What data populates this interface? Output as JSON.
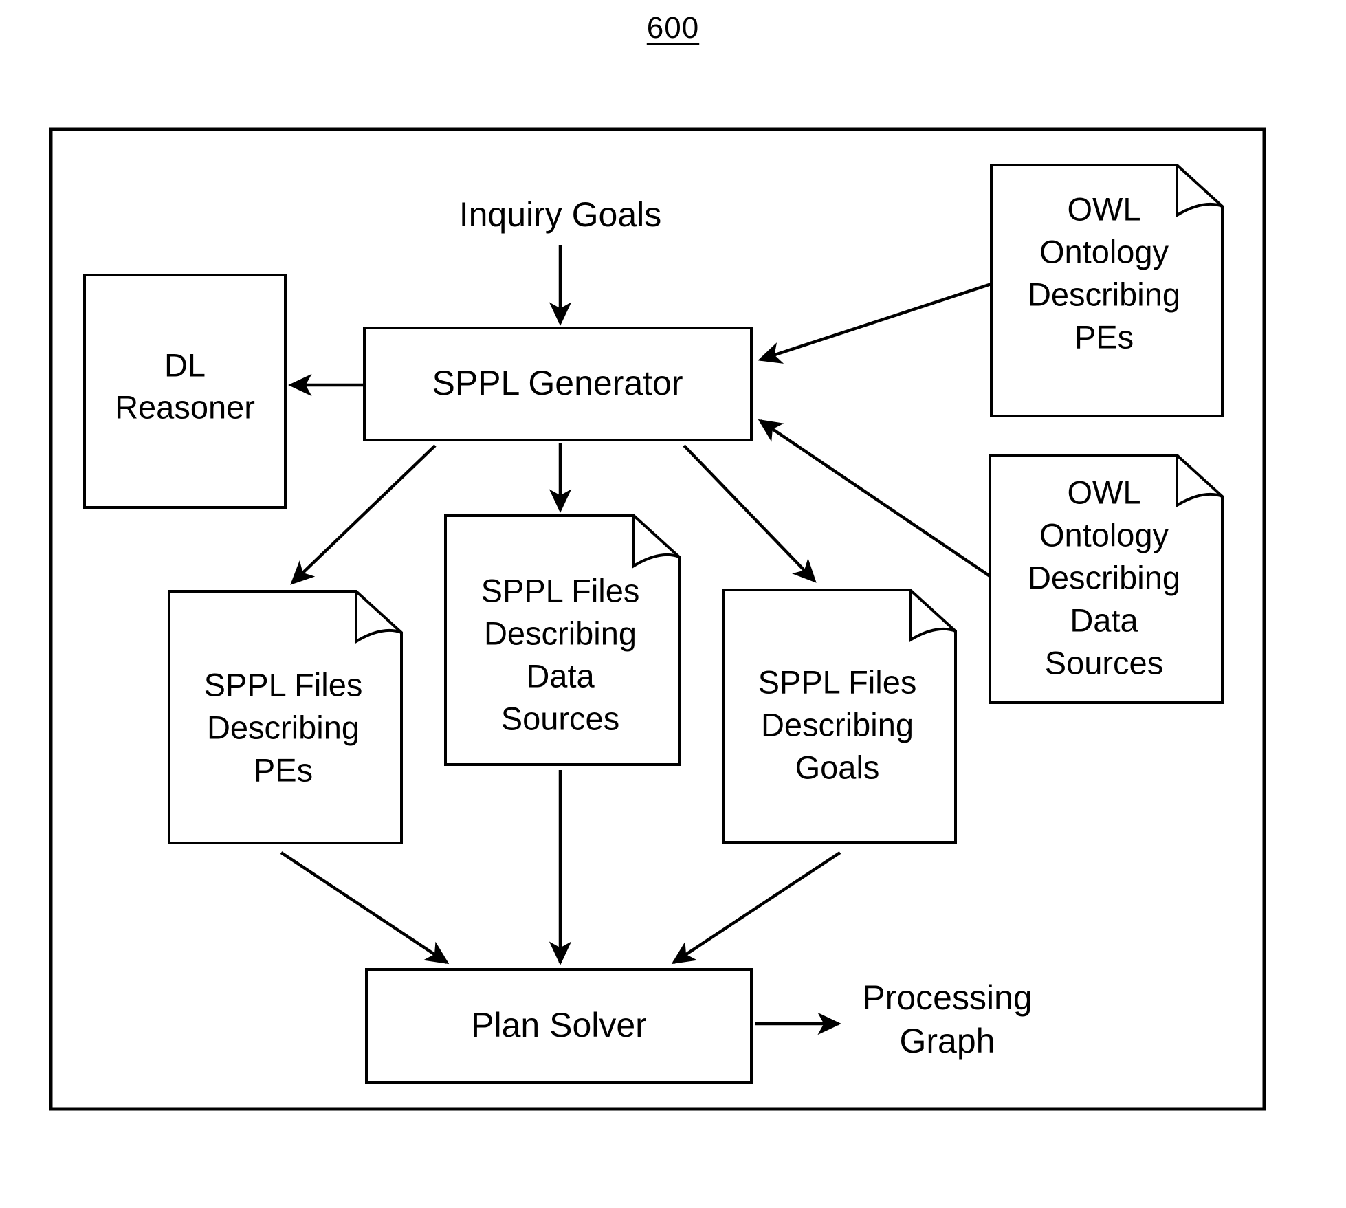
{
  "figure": {
    "number": "600"
  },
  "diagram": {
    "type": "flowchart",
    "nodes": [
      {
        "id": "inquiry-goals",
        "shape": "label",
        "lines": [
          "Inquiry Goals"
        ]
      },
      {
        "id": "dl-reasoner",
        "shape": "rect",
        "lines": [
          "DL",
          "Reasoner"
        ]
      },
      {
        "id": "sppl-generator",
        "shape": "rect",
        "lines": [
          "SPPL Generator"
        ]
      },
      {
        "id": "owl-ontology-pes",
        "shape": "document",
        "lines": [
          "OWL",
          "Ontology",
          "Describing",
          "PEs"
        ]
      },
      {
        "id": "owl-ontology-data-sources",
        "shape": "document",
        "lines": [
          "OWL",
          "Ontology",
          "Describing",
          "Data",
          "Sources"
        ]
      },
      {
        "id": "sppl-files-pes",
        "shape": "document",
        "lines": [
          "SPPL Files",
          "Describing",
          "PEs"
        ]
      },
      {
        "id": "sppl-files-data-sources",
        "shape": "document",
        "lines": [
          "SPPL Files",
          "Describing",
          "Data",
          "Sources"
        ]
      },
      {
        "id": "sppl-files-goals",
        "shape": "document",
        "lines": [
          "SPPL Files",
          "Describing",
          "Goals"
        ]
      },
      {
        "id": "plan-solver",
        "shape": "rect",
        "lines": [
          "Plan Solver"
        ]
      },
      {
        "id": "processing-graph",
        "shape": "label",
        "lines": [
          "Processing",
          "Graph"
        ]
      }
    ],
    "edges": [
      {
        "from": "inquiry-goals",
        "to": "sppl-generator"
      },
      {
        "from": "sppl-generator",
        "to": "dl-reasoner"
      },
      {
        "from": "owl-ontology-pes",
        "to": "sppl-generator"
      },
      {
        "from": "owl-ontology-data-sources",
        "to": "sppl-generator"
      },
      {
        "from": "sppl-generator",
        "to": "sppl-files-pes"
      },
      {
        "from": "sppl-generator",
        "to": "sppl-files-data-sources"
      },
      {
        "from": "sppl-generator",
        "to": "sppl-files-goals"
      },
      {
        "from": "sppl-files-pes",
        "to": "plan-solver"
      },
      {
        "from": "sppl-files-data-sources",
        "to": "plan-solver"
      },
      {
        "from": "sppl-files-goals",
        "to": "plan-solver"
      },
      {
        "from": "plan-solver",
        "to": "processing-graph"
      }
    ]
  },
  "colors": {
    "stroke": "#000000",
    "background": "#ffffff"
  }
}
